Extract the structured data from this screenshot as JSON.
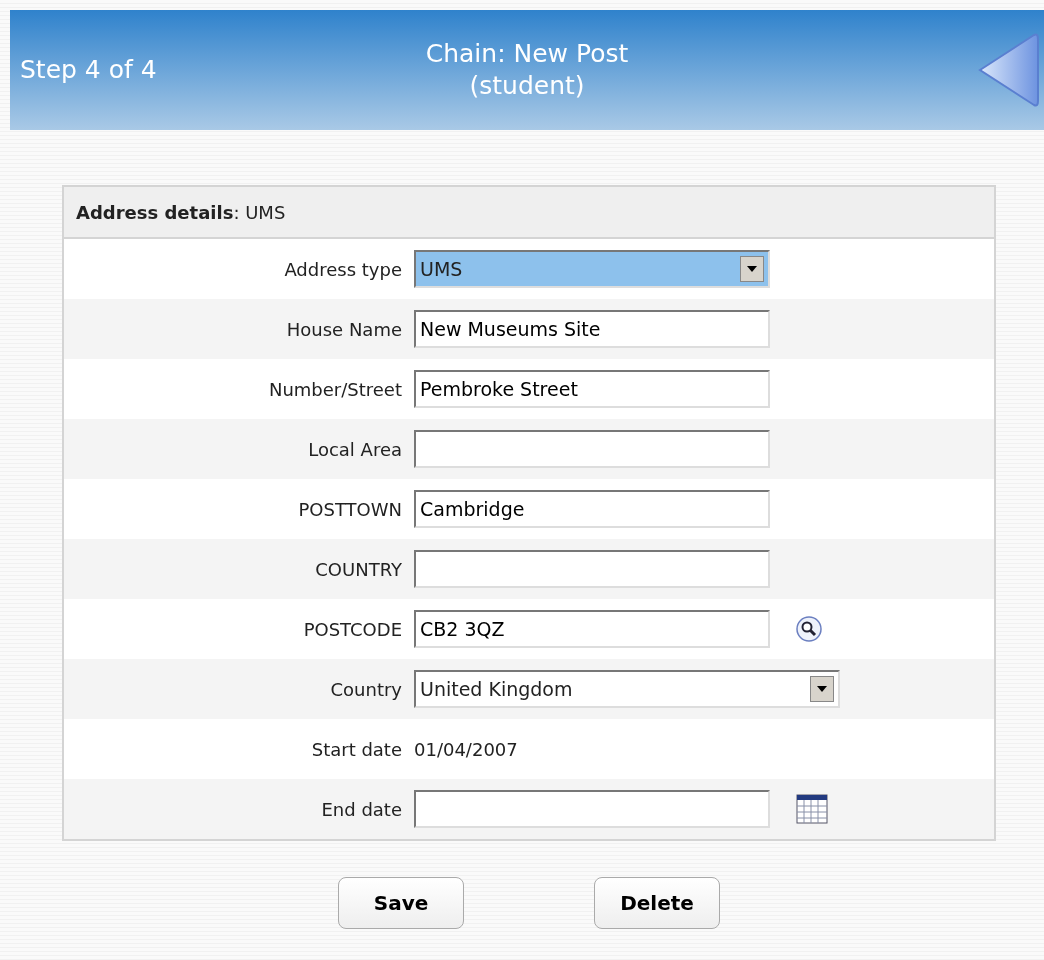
{
  "header": {
    "step": "Step 4 of 4",
    "title_line_1": "Chain: New Post",
    "title_line_2": "(student)"
  },
  "panel": {
    "heading_bold": "Address details",
    "heading_rest": ": UMS",
    "rows": [
      {
        "label": "Address type",
        "kind": "select",
        "value": "UMS",
        "focused": true,
        "wide": false
      },
      {
        "label": "House Name",
        "kind": "text",
        "value": "New Museums Site"
      },
      {
        "label": "Number/Street",
        "kind": "text",
        "value": "Pembroke Street"
      },
      {
        "label": "Local Area",
        "kind": "text"
      },
      {
        "label": "POSTTOWN",
        "kind": "text",
        "value": "Cambridge"
      },
      {
        "label": "COUNTRY",
        "kind": "text"
      },
      {
        "label": "POSTCODE",
        "kind": "text",
        "value": "CB2 3QZ",
        "tool": {
          "kind": "search"
        }
      },
      {
        "label": "Country",
        "kind": "select",
        "value": "United Kingdom",
        "focused": false,
        "wide": true
      },
      {
        "label": "Start date",
        "kind": "static",
        "value": "01/04/2007"
      },
      {
        "label": "End date",
        "kind": "text",
        "tool": {
          "kind": "calendar"
        }
      }
    ]
  },
  "buttons": [
    "Save",
    "Delete"
  ]
}
